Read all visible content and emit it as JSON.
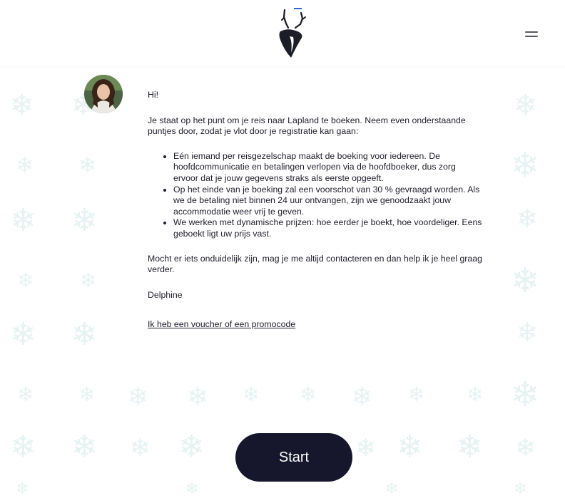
{
  "header": {
    "logo": "deer-antler-logo",
    "menu": "hamburger-menu-icon"
  },
  "message": {
    "avatar": "avatar-photo",
    "greeting": "Hi!",
    "intro": "Je staat op het punt om je reis naar Lapland te boeken. Neem even onderstaande puntjes door, zodat je vlot door je registratie kan gaan:",
    "bullets": [
      "Eén iemand per reisgezelschap maakt de boeking voor iedereen. De hoofdcommunicatie en betalingen verlopen via de hoofdboeker, dus zorg ervoor dat je jouw gegevens straks als eerste opgeeft.",
      "Op het einde van je boeking zal een voorschot van 30 % gevraagd worden. Als we de betaling niet binnen 24 uur ontvangen, zijn we genoodzaakt jouw accommodatie weer vrij te geven.",
      "We werken met dynamische prijzen: hoe eerder je boekt, hoe voordeliger. Eens geboekt ligt uw prijs vast."
    ],
    "outro": "Mocht er iets onduidelijk zijn, mag je me altijd contacteren en dan help ik je heel graag verder.",
    "signature": "Delphine",
    "voucher_link": "Ik heb een voucher of een promocode"
  },
  "actions": {
    "start_label": "Start"
  },
  "colors": {
    "button_bg": "#16162c",
    "background_pattern": "#e7f2f2",
    "text": "#1e1e2c"
  }
}
